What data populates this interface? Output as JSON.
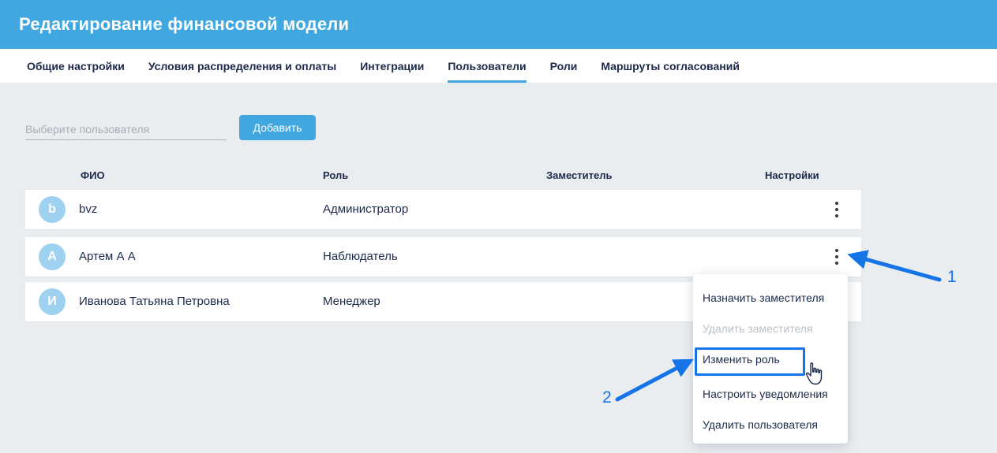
{
  "header": {
    "title": "Редактирование финансовой модели"
  },
  "tabs": [
    {
      "label": "Общие настройки",
      "active": false
    },
    {
      "label": "Условия распределения и оплаты",
      "active": false
    },
    {
      "label": "Интеграции",
      "active": false
    },
    {
      "label": "Пользователи",
      "active": true
    },
    {
      "label": "Роли",
      "active": false
    },
    {
      "label": "Маршруты согласований",
      "active": false
    }
  ],
  "toolbar": {
    "user_select_placeholder": "Выберите пользователя",
    "add_button_label": "Добавить"
  },
  "table": {
    "columns": {
      "fio": "ФИО",
      "role": "Роль",
      "deputy": "Заместитель",
      "settings": "Настройки"
    },
    "rows": [
      {
        "initial": "b",
        "name": "bvz",
        "role": "Администратор",
        "deputy": ""
      },
      {
        "initial": "A",
        "name": "Артем А А",
        "role": "Наблюдатель",
        "deputy": ""
      },
      {
        "initial": "И",
        "name": "Иванова Татьяна Петровна",
        "role": "Менеджер",
        "deputy": ""
      }
    ]
  },
  "context_menu": {
    "items": [
      {
        "label": "Назначить заместителя",
        "state": "normal"
      },
      {
        "label": "Удалить заместителя",
        "state": "disabled"
      },
      {
        "label": "Изменить роль",
        "state": "highlighted"
      },
      {
        "label": "Настроить уведомления",
        "state": "normal"
      },
      {
        "label": "Удалить пользователя",
        "state": "normal"
      }
    ]
  },
  "annotations": {
    "step1": "1",
    "step2": "2"
  },
  "colors": {
    "accent": "#41a7e0",
    "annotation_blue": "#1574e8",
    "avatar_blue": "#9fd2f0",
    "page_background": "#eaedf0",
    "text_dark": "#1b2a4a",
    "disabled_text": "#b9c0c7"
  }
}
